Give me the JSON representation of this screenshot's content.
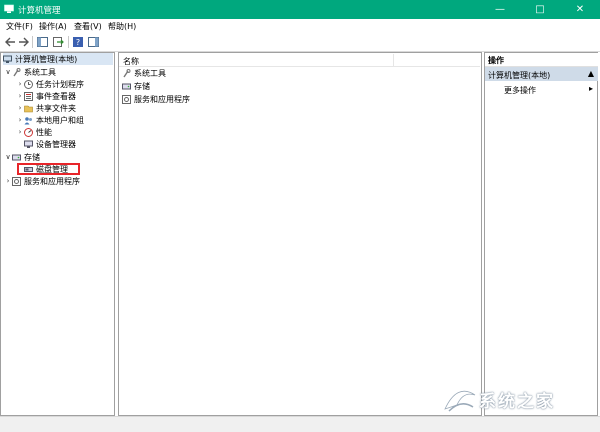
{
  "window": {
    "title": "计算机管理"
  },
  "menu": [
    "文件(F)",
    "操作(A)",
    "查看(V)",
    "帮助(H)"
  ],
  "tree": {
    "root": "计算机管理(本地)",
    "system_tools": "系统工具",
    "system_children": [
      "任务计划程序",
      "事件查看器",
      "共享文件夹",
      "本地用户和组",
      "性能",
      "设备管理器"
    ],
    "storage": "存储",
    "disk_management": "磁盘管理",
    "services": "服务和应用程序"
  },
  "list": {
    "column_name": "名称",
    "rows": [
      "系统工具",
      "存储",
      "服务和应用程序"
    ]
  },
  "actions": {
    "header": "操作",
    "selected": "计算机管理(本地)",
    "more": "更多操作"
  },
  "watermark": {
    "text": "系统之家"
  },
  "colors": {
    "titlebar": "#00a87e",
    "highlight_box": "#e8252a",
    "selected_action": "#cfdbe8"
  }
}
